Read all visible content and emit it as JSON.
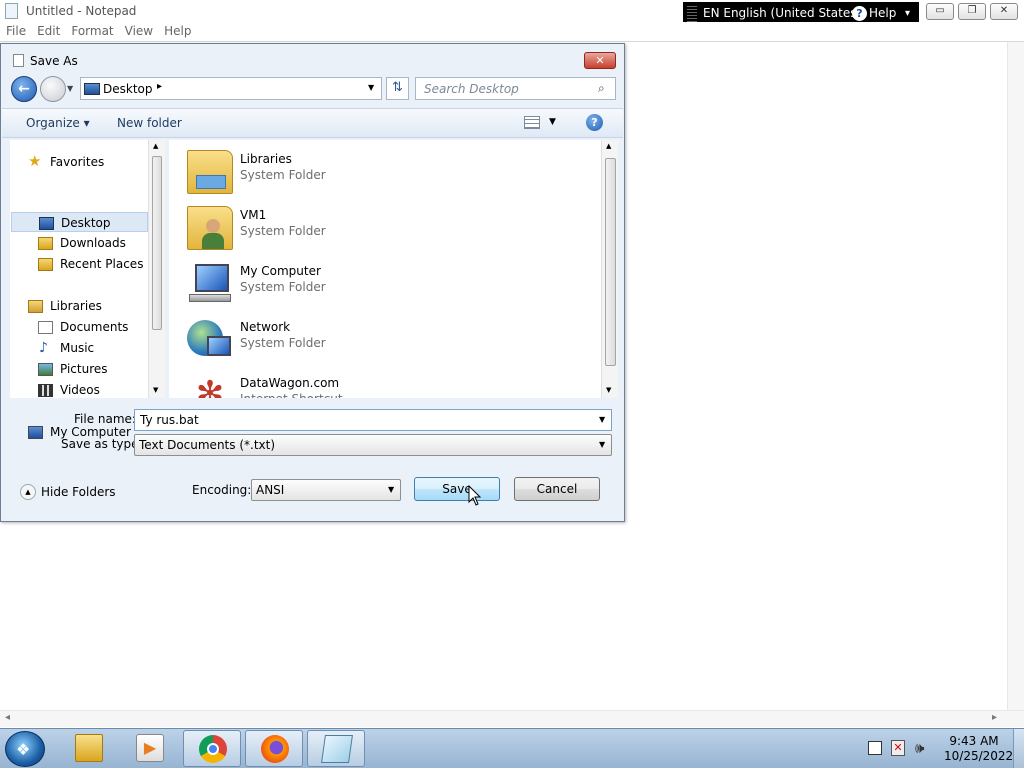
{
  "notepad": {
    "title": "Untitled - Notepad",
    "menu": [
      "File",
      "Edit",
      "Format",
      "View",
      "Help"
    ],
    "minimize": "▭",
    "maximize": "❐",
    "close": "✕"
  },
  "language_bar": {
    "language": "EN English (United States)",
    "help": "Help"
  },
  "dialog": {
    "title": "Save As",
    "close": "✕",
    "address": {
      "location": "Desktop",
      "separator": "▸"
    },
    "search_placeholder": "Search Desktop",
    "toolbar": {
      "organize": "Organize ▾",
      "new_folder": "New folder",
      "help": "?"
    },
    "nav_pane": [
      {
        "label": "Favorites",
        "icon": "star-icon",
        "indent": 0
      },
      {
        "label": "Desktop",
        "icon": "desktop-icon",
        "indent": 1,
        "selected": true
      },
      {
        "label": "Downloads",
        "icon": "downloads-folder-icon",
        "indent": 1
      },
      {
        "label": "Recent Places",
        "icon": "recent-places-icon",
        "indent": 1
      },
      {
        "label": "Libraries",
        "icon": "libraries-icon",
        "indent": 0
      },
      {
        "label": "Documents",
        "icon": "documents-icon",
        "indent": 1
      },
      {
        "label": "Music",
        "icon": "music-icon",
        "indent": 1
      },
      {
        "label": "Pictures",
        "icon": "pictures-icon",
        "indent": 1
      },
      {
        "label": "Videos",
        "icon": "videos-icon",
        "indent": 1
      },
      {
        "label": "My Computer",
        "icon": "computer-icon",
        "indent": 0
      }
    ],
    "files": [
      {
        "name": "Libraries",
        "type": "System Folder",
        "icon": "libraries-folder-icon"
      },
      {
        "name": "VM1",
        "type": "System Folder",
        "icon": "user-folder-icon"
      },
      {
        "name": "My Computer",
        "type": "System Folder",
        "icon": "computer-icon"
      },
      {
        "name": "Network",
        "type": "System Folder",
        "icon": "network-icon"
      },
      {
        "name": "DataWagon.com",
        "type": "Internet Shortcut",
        "icon": "internet-shortcut-icon"
      }
    ],
    "file_name_label": "File name:",
    "file_name_value": "Ty rus.bat",
    "save_as_type_label": "Save as type:",
    "save_as_type_value": "Text Documents (*.txt)",
    "hide_folders": "Hide Folders",
    "encoding_label": "Encoding:",
    "encoding_value": "ANSI",
    "save": "Save",
    "cancel": "Cancel"
  },
  "taskbar": {
    "pinned": [
      "windows-explorer-icon",
      "media-player-icon",
      "chrome-icon",
      "firefox-icon",
      "notepad-icon"
    ],
    "time": "9:43 AM",
    "date": "10/25/2022"
  }
}
